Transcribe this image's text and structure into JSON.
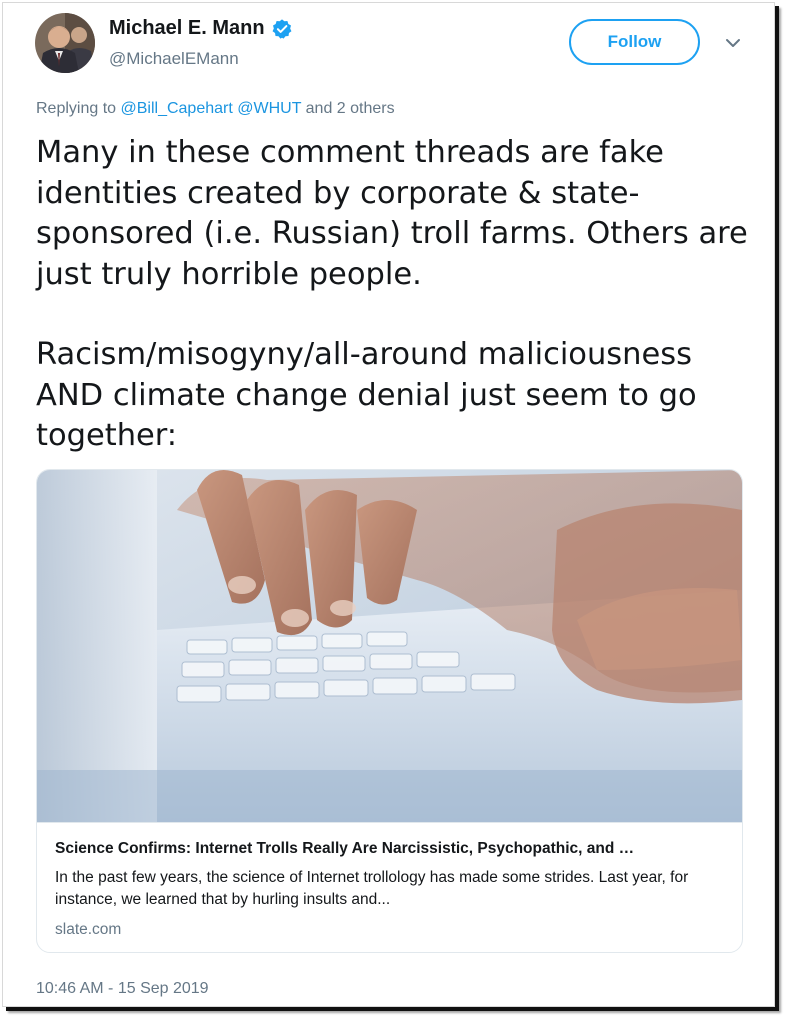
{
  "tweet": {
    "author": {
      "display_name": "Michael E. Mann",
      "handle": "@MichaelEMann",
      "avatar_icon": "avatar-photo",
      "verified_icon": "verified-badge-icon"
    },
    "follow_label": "Follow",
    "more_icon": "chevron-down-icon",
    "replying": {
      "prefix": "Replying to",
      "mention_1": "@Bill_Capehart",
      "mention_2": "@WHUT",
      "suffix": "and 2 others"
    },
    "text": {
      "paragraph_1": "Many in these comment threads are fake identities created by corporate & state-sponsored (i.e. Russian) troll farms. Others are just truly horrible people.",
      "paragraph_2": "Racism/misogyny/all-around maliciousness AND climate change denial just seem to go together:"
    },
    "card": {
      "image_icon": "hands-typing-on-keyboard-photo",
      "title": "Science Confirms: Internet Trolls Really Are Narcissistic, Psychopathic, and …",
      "description": "In the past few years, the science of Internet trollology has made some strides. Last year, for instance, we learned that by hurling insults and...",
      "domain": "slate.com"
    },
    "timestamp": "10:46 AM - 15 Sep 2019"
  },
  "colors": {
    "accent": "#1da1f2",
    "mention": "#1b95e0",
    "text": "#14171a",
    "muted": "#657786",
    "border": "#e1e8ed"
  }
}
